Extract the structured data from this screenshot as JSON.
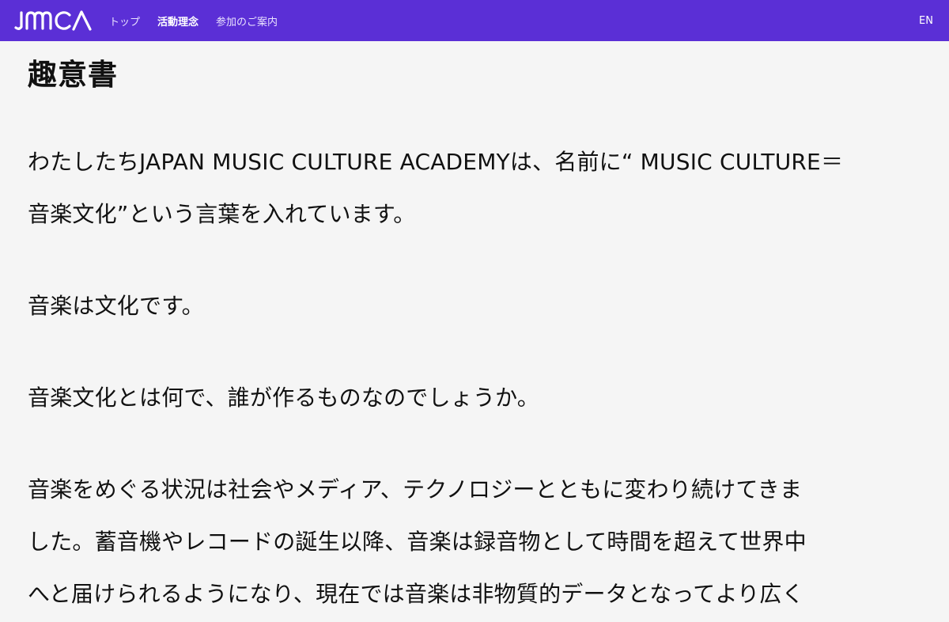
{
  "header": {
    "logo_text": "JMCA",
    "nav": [
      {
        "label": "トップ",
        "active": false
      },
      {
        "label": "活動理念",
        "active": true
      },
      {
        "label": "参加のご案内",
        "active": false
      }
    ],
    "lang": "EN",
    "colors": {
      "brand": "#5b2fd6",
      "text": "#ffffff"
    }
  },
  "main": {
    "title": "趣意書",
    "paragraphs": [
      {
        "lines": [
          "わたしたちJAPAN MUSIC CULTURE ACADEMYは、名前に“ MUSIC CULTURE＝",
          "音楽文化”という言葉を入れています。"
        ]
      },
      {
        "lines": [
          "音楽は文化です。"
        ]
      },
      {
        "lines": [
          "音楽文化とは何で、誰が作るものなのでしょうか。"
        ]
      },
      {
        "lines": [
          "音楽をめぐる状況は社会やメディア、テクノロジーとともに変わり続けてきま",
          "した。蓄音機やレコードの誕生以降、音楽は録音物として時間を超えて世界中",
          "へと届けられるようになり、現在では音楽は非物質的データとなってより広く"
        ]
      }
    ]
  }
}
